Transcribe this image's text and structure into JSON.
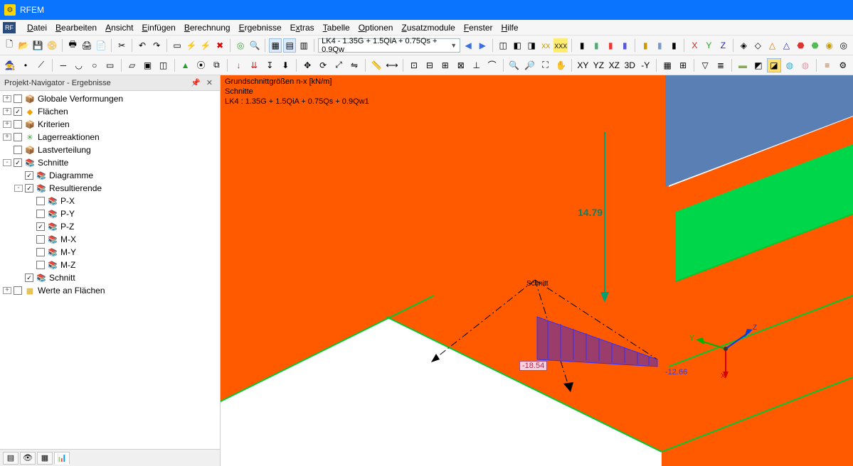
{
  "app": {
    "title": "RFEM"
  },
  "menu": {
    "items": [
      {
        "label": "Datei",
        "u": 0
      },
      {
        "label": "Bearbeiten",
        "u": 0
      },
      {
        "label": "Ansicht",
        "u": 0
      },
      {
        "label": "Einfügen",
        "u": 0
      },
      {
        "label": "Berechnung",
        "u": 0
      },
      {
        "label": "Ergebnisse",
        "u": 0
      },
      {
        "label": "Extras",
        "u": 1
      },
      {
        "label": "Tabelle",
        "u": 0
      },
      {
        "label": "Optionen",
        "u": 0
      },
      {
        "label": "Zusatzmodule",
        "u": 0
      },
      {
        "label": "Fenster",
        "u": 0
      },
      {
        "label": "Hilfe",
        "u": 0
      }
    ]
  },
  "toolbar1": {
    "combo_value": "LK4 - 1.35G + 1.5QiA + 0.75Qs + 0.9Qw"
  },
  "navigator": {
    "title": "Projekt-Navigator - Ergebnisse",
    "tree": [
      {
        "level": 1,
        "exp": "+",
        "chk": false,
        "icon": "📦",
        "iconColor": "#888",
        "label": "Globale Verformungen"
      },
      {
        "level": 1,
        "exp": "+",
        "chk": true,
        "icon": "◆",
        "iconColor": "#f0a000",
        "label": "Flächen"
      },
      {
        "level": 1,
        "exp": "+",
        "chk": false,
        "icon": "📦",
        "iconColor": "#888",
        "label": "Kriterien"
      },
      {
        "level": 1,
        "exp": "+",
        "chk": false,
        "icon": "✳",
        "iconColor": "#2a9a2a",
        "label": "Lagerreaktionen"
      },
      {
        "level": 1,
        "exp": "",
        "chk": false,
        "icon": "📦",
        "iconColor": "#888",
        "label": "Lastverteilung"
      },
      {
        "level": 1,
        "exp": "-",
        "chk": true,
        "icon": "📚",
        "iconColor": "#3a6fe0",
        "label": "Schnitte"
      },
      {
        "level": 2,
        "exp": "",
        "chk": true,
        "icon": "📚",
        "iconColor": "#3a6fe0",
        "label": "Diagramme"
      },
      {
        "level": 2,
        "exp": "-",
        "chk": true,
        "icon": "📚",
        "iconColor": "#3a6fe0",
        "label": "Resultierende"
      },
      {
        "level": 3,
        "exp": "",
        "chk": false,
        "icon": "📚",
        "iconColor": "#3a6fe0",
        "label": "P-X"
      },
      {
        "level": 3,
        "exp": "",
        "chk": false,
        "icon": "📚",
        "iconColor": "#3a6fe0",
        "label": "P-Y"
      },
      {
        "level": 3,
        "exp": "",
        "chk": true,
        "icon": "📚",
        "iconColor": "#3a6fe0",
        "label": "P-Z"
      },
      {
        "level": 3,
        "exp": "",
        "chk": false,
        "icon": "📚",
        "iconColor": "#3a6fe0",
        "label": "M-X"
      },
      {
        "level": 3,
        "exp": "",
        "chk": false,
        "icon": "📚",
        "iconColor": "#3a6fe0",
        "label": "M-Y"
      },
      {
        "level": 3,
        "exp": "",
        "chk": false,
        "icon": "📚",
        "iconColor": "#3a6fe0",
        "label": "M-Z"
      },
      {
        "level": 2,
        "exp": "",
        "chk": true,
        "icon": "📚",
        "iconColor": "#3a6fe0",
        "label": "Schnitt"
      },
      {
        "level": 1,
        "exp": "+",
        "chk": false,
        "icon": "▦",
        "iconColor": "#d9a400",
        "label": "Werte an Flächen"
      }
    ]
  },
  "viewport": {
    "overlay": [
      "Grundschnittgrößen n-x [kN/m]",
      "Schnitte",
      "LK4 : 1.35G + 1.5QiA + 0.75Qs + 0.9Qw1"
    ],
    "section_label": "Schnitt",
    "results": {
      "top_value": "14.79",
      "left_value": "-18.54",
      "right_value": "-12.66"
    },
    "axes": {
      "x": "X",
      "y": "Y",
      "z": "Z"
    },
    "colors": {
      "wall": "#ff5a00",
      "panel_blue": "#5a7fb5",
      "panel_green": "#00d64a",
      "edge_green": "#00c830",
      "diagram_fill": "#9a3d6a",
      "diagram_line": "#3030ff",
      "arrow_green": "#00a070"
    }
  }
}
